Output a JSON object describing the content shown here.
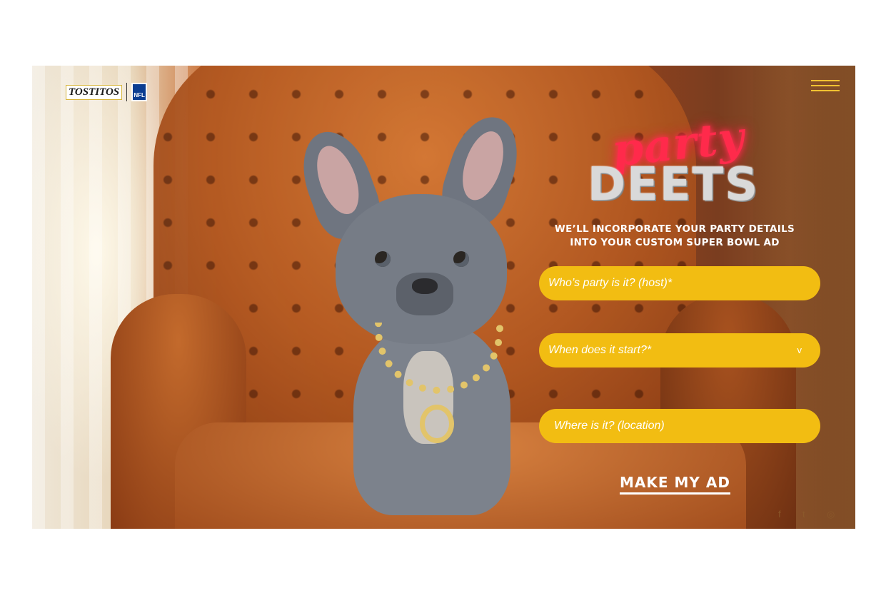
{
  "brand": {
    "logo_text": "TOSTITOS",
    "partner_text": "NFL"
  },
  "hero": {
    "title_script": "party",
    "title_block": "DEETS",
    "subhead_line1": "WE’LL INCORPORATE YOUR PARTY DETAILS",
    "subhead_line2": "INTO YOUR CUSTOM SUPER BOWL AD"
  },
  "form": {
    "host_placeholder": "Who’s party is it? (host)*",
    "start_placeholder": "When does it start?*",
    "start_caret": "v",
    "location_placeholder": "Where is it? (location)",
    "submit_label": "MAKE MY AD"
  },
  "social": {
    "facebook": "f",
    "twitter": "t",
    "instagram": "◎"
  },
  "colors": {
    "field_yellow": "#f2bd12",
    "neon_pink": "#ff2a4b",
    "menu_gold": "#f1c232"
  },
  "icons": [
    "menu-icon",
    "facebook-icon",
    "twitter-icon",
    "instagram-icon",
    "chevron-down-icon"
  ]
}
